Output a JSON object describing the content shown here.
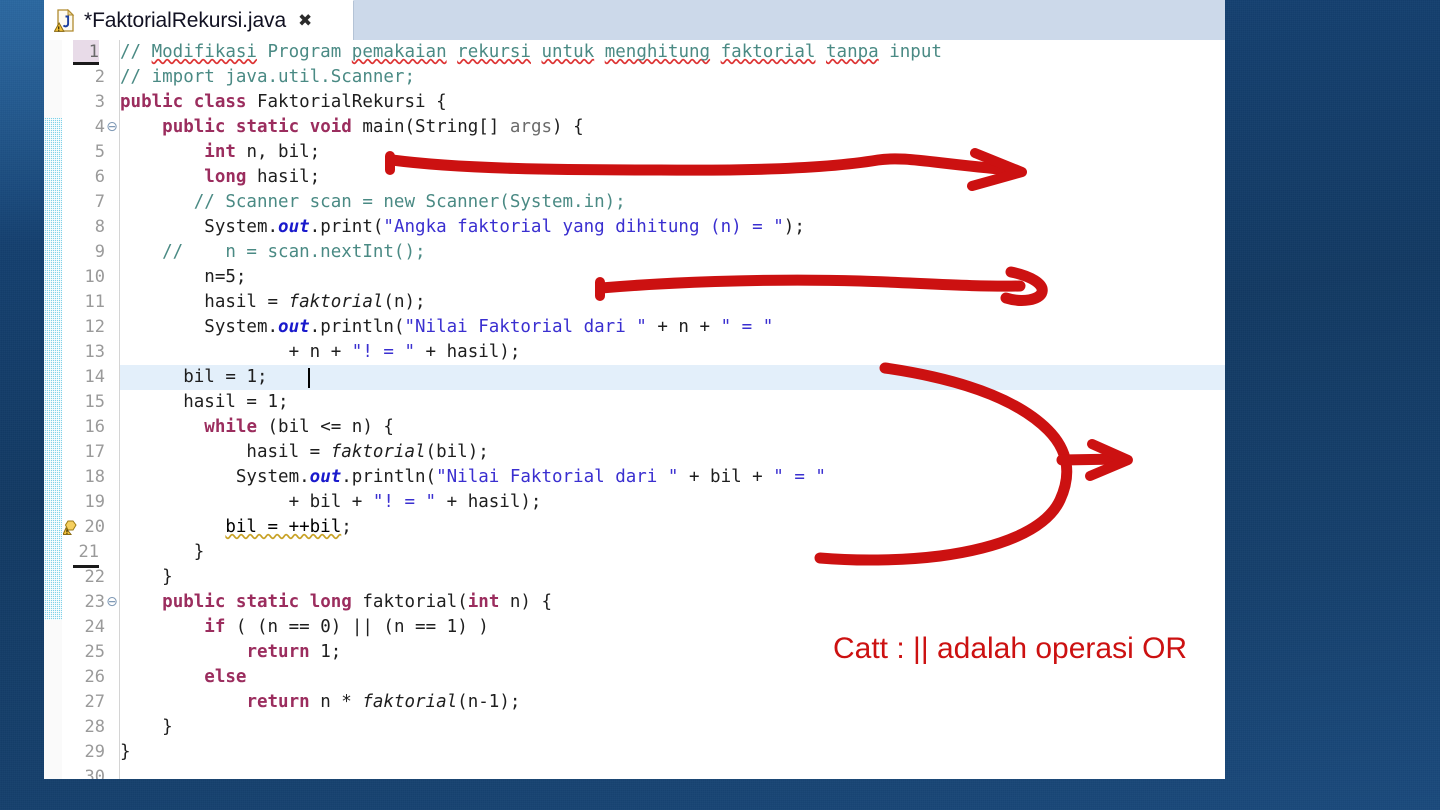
{
  "window": {
    "tab": {
      "label": "*FaktorialRekursi.java",
      "close_glyph": "✖",
      "icon_name": "java-file-warning-icon"
    }
  },
  "editor": {
    "current_line": 14,
    "caret_line": 14,
    "lines": [
      {
        "n": 1,
        "text": "// Modifikasi Program pemakaian rekursi untuk menghitung faktorial tanpa input"
      },
      {
        "n": 2,
        "text": "// import java.util.Scanner;"
      },
      {
        "n": 3,
        "text": "public class FaktorialRekursi {"
      },
      {
        "n": 4,
        "text": "    public static void main(String[] args) {"
      },
      {
        "n": 5,
        "text": "        int n, bil;"
      },
      {
        "n": 6,
        "text": "        long hasil;"
      },
      {
        "n": 7,
        "text": "       // Scanner scan = new Scanner(System.in);"
      },
      {
        "n": 8,
        "text": "        System.out.print(\"Angka faktorial yang dihitung (n) = \");"
      },
      {
        "n": 9,
        "text": "    //    n = scan.nextInt();"
      },
      {
        "n": 10,
        "text": "        n=5;"
      },
      {
        "n": 11,
        "text": "        hasil = faktorial(n);"
      },
      {
        "n": 12,
        "text": "        System.out.println(\"Nilai Faktorial dari \" + n + \" = \""
      },
      {
        "n": 13,
        "text": "                + n + \"! = \" + hasil);"
      },
      {
        "n": 14,
        "text": "      bil = 1;"
      },
      {
        "n": 15,
        "text": "      hasil = 1;"
      },
      {
        "n": 16,
        "text": "        while (bil <= n) {"
      },
      {
        "n": 17,
        "text": "            hasil = faktorial(bil);"
      },
      {
        "n": 18,
        "text": "           System.out.println(\"Nilai Faktorial dari \" + bil + \" = \""
      },
      {
        "n": 19,
        "text": "                + bil + \"! = \" + hasil);"
      },
      {
        "n": 20,
        "text": "          bil = ++bil;"
      },
      {
        "n": 21,
        "text": "       }"
      },
      {
        "n": 22,
        "text": "    }"
      },
      {
        "n": 23,
        "text": "    public static long faktorial(int n) {"
      },
      {
        "n": 24,
        "text": "        if ( (n == 0) || (n == 1) )"
      },
      {
        "n": 25,
        "text": "            return 1;"
      },
      {
        "n": 26,
        "text": "        else"
      },
      {
        "n": 27,
        "text": "            return n * faktorial(n-1);"
      },
      {
        "n": 28,
        "text": "    }"
      },
      {
        "n": 29,
        "text": "}"
      },
      {
        "n": 30,
        "text": ""
      }
    ],
    "fold_markers": [
      4,
      23
    ],
    "warning_markers": [
      20
    ],
    "underlined_line_numbers": [
      1,
      21
    ]
  },
  "annotations": {
    "note_text": "Catt : || adalah operasi OR",
    "ink_color": "#cc1111",
    "marks": [
      {
        "name": "arrow-line-5",
        "kind": "arrow"
      },
      {
        "name": "arrow-line-10",
        "kind": "arrow"
      },
      {
        "name": "brace-arrow-while-block",
        "kind": "brace-arrow"
      }
    ]
  },
  "colors": {
    "desktop_background": "#14406f",
    "tab_strip": "#ccd9ea",
    "editor_background": "#ffffff",
    "current_line_highlight": "#e3effa",
    "keyword": "#9b2d5e",
    "comment": "#4a8a84",
    "string": "#3a2fd0",
    "static_field": "#1a1acc",
    "line_number": "#9a9a9a",
    "annotation_ruler": "#7fd2e8",
    "ink": "#cc1111"
  }
}
